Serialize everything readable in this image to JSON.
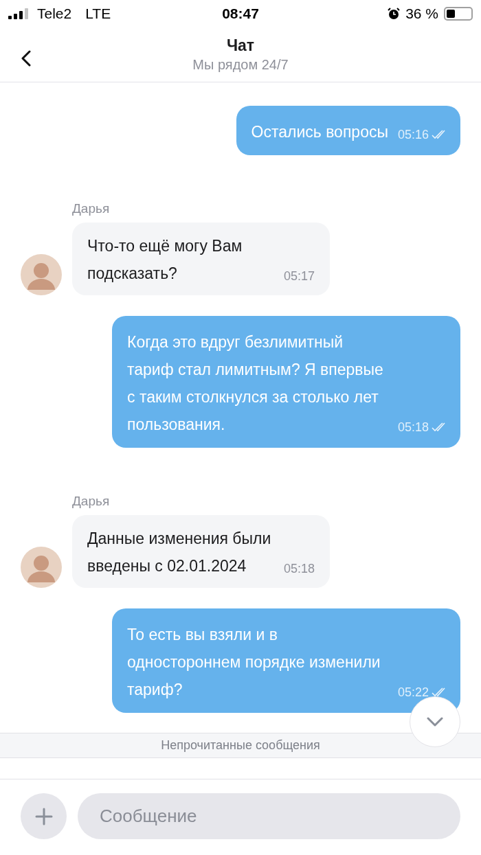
{
  "status_bar": {
    "carrier": "Tele2",
    "network": "LTE",
    "time": "08:47",
    "battery": "36 %"
  },
  "header": {
    "title": "Чат",
    "subtitle": "Мы рядом 24/7"
  },
  "messages": [
    {
      "kind": "outgoing",
      "text": "Остались вопросы",
      "time": "05:16",
      "read": true
    },
    {
      "kind": "incoming",
      "sender": "Дарья",
      "text": "Что-то ещё могу Вам подсказать?",
      "time": "05:17"
    },
    {
      "kind": "outgoing",
      "text": "Когда это вдруг безлимитный тариф стал лимитным? Я впервые с таким столкнулся за столько лет пользования.",
      "time": "05:18",
      "read": true
    },
    {
      "kind": "incoming",
      "sender": "Дарья",
      "text": "Данные изменения были введены с 02.01.2024",
      "time": "05:18"
    },
    {
      "kind": "outgoing",
      "text": "То есть вы взяли и в одностороннем порядке изменили тариф?",
      "time": "05:22",
      "read": true
    }
  ],
  "unread_divider": "Непрочитанные сообщения",
  "composer": {
    "placeholder": "Сообщение"
  }
}
